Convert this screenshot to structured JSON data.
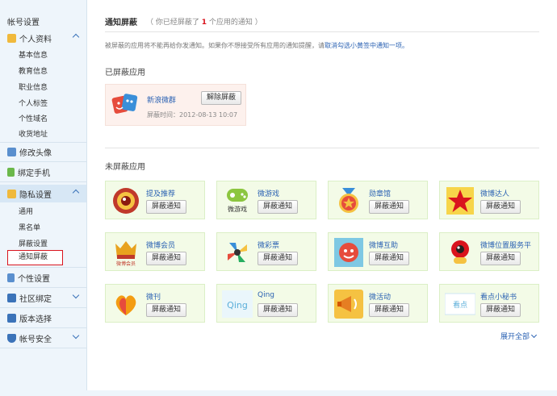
{
  "sidebar": {
    "heading": "帐号设置",
    "sections": [
      {
        "label": "个人资料",
        "icon": "id-card-icon"
      },
      {
        "label": "修改头像",
        "icon": "avatar-icon"
      },
      {
        "label": "绑定手机",
        "icon": "phone-icon"
      },
      {
        "label": "隐私设置",
        "icon": "lock-icon"
      },
      {
        "label": "个性设置",
        "icon": "wrench-icon"
      },
      {
        "label": "社区绑定",
        "icon": "community-icon"
      },
      {
        "label": "版本选择",
        "icon": "version-icon"
      },
      {
        "label": "帐号安全",
        "icon": "shield-icon"
      }
    ],
    "profile_items": [
      "基本信息",
      "教育信息",
      "职业信息",
      "个人标签",
      "个性域名",
      "收货地址"
    ],
    "privacy_items": [
      "通用",
      "黑名单",
      "屏蔽设置",
      "通知屏蔽"
    ]
  },
  "main": {
    "title": "通知屏蔽",
    "note_prefix": "（ 你已经屏蔽了",
    "note_count": "1",
    "note_suffix": "个应用的通知 ）",
    "tip_text": "被屏蔽的应用将不能再给你发通知。如果你不想接受所有应用的通知提醒，请",
    "tip_link": "取消勾选小黄签中通知一项。",
    "blocked_heading": "已屏蔽应用",
    "blocked": {
      "name": "新浪微群",
      "time": "屏蔽时间：2012-08-13 10:07",
      "button": "解除屏蔽"
    },
    "unblocked_heading": "未屏蔽应用",
    "block_button": "屏蔽通知",
    "apps": [
      {
        "name": "提及推荐"
      },
      {
        "name": "微游戏",
        "logo_text": "微游戏"
      },
      {
        "name": "勋章馆"
      },
      {
        "name": "微博达人"
      },
      {
        "name": "微博会员",
        "logo_text": "微博会员"
      },
      {
        "name": "微彩票"
      },
      {
        "name": "微博互助"
      },
      {
        "name": "微博位置服务平"
      },
      {
        "name": "微刊"
      },
      {
        "name": "Qing",
        "logo_text": "Qing"
      },
      {
        "name": "微活动"
      },
      {
        "name": "看点小秘书",
        "logo_text": "看点"
      }
    ],
    "expand_all": "展开全部"
  },
  "colors": {
    "accent": "#2b62b3",
    "highlight": "#d9141e",
    "card_bg": "#f3fbe7",
    "blocked_bg": "#fdf1ed",
    "sidebar_bg": "#eef5fb"
  }
}
